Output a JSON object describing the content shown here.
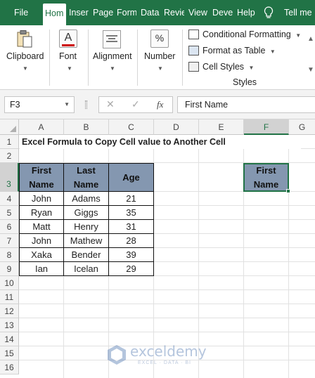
{
  "tabs": [
    "File",
    "Hom",
    "Inser",
    "Page",
    "Form",
    "Data",
    "Revie",
    "View",
    "Deve",
    "Help",
    "Tell me"
  ],
  "ribbon": {
    "clipboard": "Clipboard",
    "font": "Font",
    "alignment": "Alignment",
    "number": "Number",
    "percent": "%",
    "font_icon": "A",
    "styles_items": [
      "Conditional Formatting",
      "Format as Table",
      "Cell Styles"
    ],
    "styles_group": "Styles"
  },
  "formula_bar": {
    "name_box": "F3",
    "fx": "fx",
    "cancel": "✕",
    "enter": "✓",
    "content": "First Name"
  },
  "columns": [
    "A",
    "B",
    "C",
    "D",
    "E",
    "F",
    "G"
  ],
  "rows": [
    "1",
    "2",
    "3",
    "4",
    "5",
    "6",
    "7",
    "8",
    "9",
    "10",
    "11",
    "12",
    "13",
    "14",
    "15",
    "16"
  ],
  "sheet": {
    "title": "Excel Formula to Copy Cell value to Another Cell",
    "headers": [
      [
        "First",
        "Name"
      ],
      [
        "Last",
        "Name"
      ],
      [
        "Age"
      ]
    ],
    "table": [
      [
        "John",
        "Adams",
        "21"
      ],
      [
        "Ryan",
        "Giggs",
        "35"
      ],
      [
        "Matt",
        "Henry",
        "31"
      ],
      [
        "John",
        "Mathew",
        "28"
      ],
      [
        "Xaka",
        "Bender",
        "39"
      ],
      [
        "Ian",
        "Icelan",
        "29"
      ]
    ],
    "copied_cell": [
      "First",
      "Name"
    ]
  },
  "watermark": {
    "name": "exceldemy",
    "tagline": "EXCEL · DATA · BI"
  },
  "colors": {
    "excel_green": "#217346",
    "header_fill": "#8497b0"
  }
}
